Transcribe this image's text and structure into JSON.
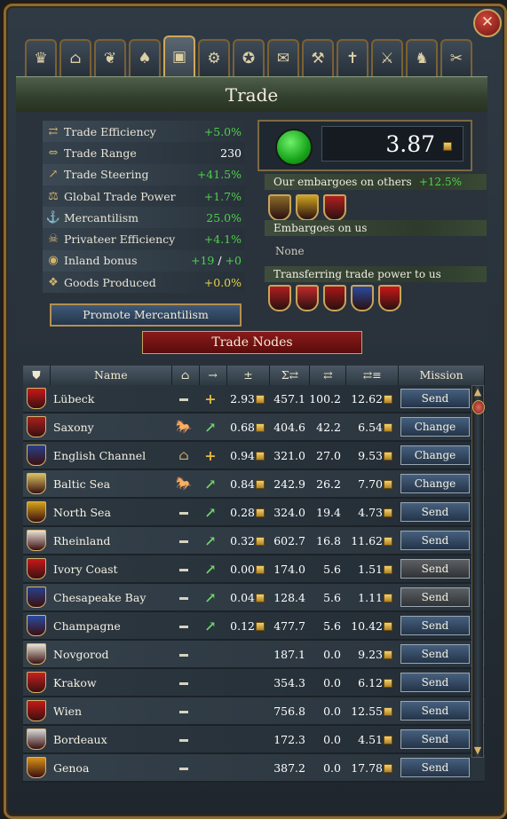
{
  "window": {
    "title": "Trade",
    "close_label": "✕"
  },
  "tabs": [
    {
      "icon": "crown-icon",
      "glyph": "♛"
    },
    {
      "icon": "building-icon",
      "glyph": "⌂"
    },
    {
      "icon": "dove-icon",
      "glyph": "❦"
    },
    {
      "icon": "sacks-icon",
      "glyph": "♠"
    },
    {
      "icon": "trade-crate-icon",
      "glyph": "▣"
    },
    {
      "icon": "gear-icon",
      "glyph": "⚙"
    },
    {
      "icon": "bulb-icon",
      "glyph": "✪"
    },
    {
      "icon": "scroll-icon",
      "glyph": "✉"
    },
    {
      "icon": "hammer-icon",
      "glyph": "⚒"
    },
    {
      "icon": "cross-icon",
      "glyph": "✝"
    },
    {
      "icon": "cannon-icon",
      "glyph": "⚔"
    },
    {
      "icon": "helmet-icon",
      "glyph": "♞"
    },
    {
      "icon": "tools-icon",
      "glyph": "✂"
    }
  ],
  "stats": [
    {
      "icon": "trade-efficiency-icon",
      "glyph": "⇄",
      "label": "Trade Efficiency",
      "value": "+5.0%",
      "color": "green"
    },
    {
      "icon": "trade-range-icon",
      "glyph": "⇔",
      "label": "Trade Range",
      "value": "230",
      "color": "white"
    },
    {
      "icon": "trade-steering-icon",
      "glyph": "↗",
      "label": "Trade Steering",
      "value": "+41.5%",
      "color": "green"
    },
    {
      "icon": "global-trade-power-icon",
      "glyph": "⚖",
      "label": "Global Trade Power",
      "value": "+1.7%",
      "color": "green"
    },
    {
      "icon": "mercantilism-icon",
      "glyph": "⚓",
      "label": "Mercantilism",
      "value": "25.0%",
      "color": "green"
    },
    {
      "icon": "privateer-icon",
      "glyph": "☠",
      "label": "Privateer Efficiency",
      "value": "+4.1%",
      "color": "green"
    },
    {
      "icon": "inland-bonus-icon",
      "glyph": "◉",
      "label": "Inland bonus",
      "value_a": "+19",
      "sep": " / ",
      "value_b": "+0",
      "color": "green"
    },
    {
      "icon": "goods-produced-icon",
      "glyph": "❖",
      "label": "Goods Produced",
      "value": "+0.0%",
      "color": "yellow"
    }
  ],
  "promote_label": "Promote Mercantilism",
  "income": {
    "value": "3.87"
  },
  "embargoes_others": {
    "label": "Our embargoes on others",
    "value": "+12.5%",
    "shields": [
      "#8a6a2a",
      "#c9a020",
      "#b02020"
    ]
  },
  "embargoes_us": {
    "label": "Embargoes on us",
    "none_label": "None"
  },
  "transferring": {
    "label": "Transferring trade power to us",
    "shields": [
      "#b01e1e",
      "#c02a2a",
      "#a81818",
      "#2a4aa0",
      "#c81818"
    ]
  },
  "nodes_banner": "Trade Nodes",
  "table": {
    "headers": {
      "name": "Name",
      "home_icon": "⌂",
      "arrow_icon": "→",
      "plusminus": "±",
      "total_icon": "Σ⇄",
      "own_icon": "⇄",
      "income_icon": "⇄≡",
      "mission": "Mission"
    },
    "rows": [
      {
        "flag": "#c81818",
        "name": "Lübeck",
        "home": "—",
        "arrow": "+",
        "val": "2.93",
        "total": "457.1",
        "own": "100.2",
        "income": "12.62",
        "mission": "Send",
        "dark": false
      },
      {
        "flag": "#a8201c",
        "name": "Saxony",
        "home": "🐎",
        "arrow": "↗",
        "val": "0.68",
        "total": "404.6",
        "own": "42.2",
        "income": "6.54",
        "mission": "Change",
        "dark": false
      },
      {
        "flag": "#2a3f8a",
        "name": "English Channel",
        "home": "⌂",
        "arrow": "+",
        "val": "0.94",
        "total": "321.0",
        "own": "27.0",
        "income": "9.53",
        "mission": "Change",
        "dark": false
      },
      {
        "flag": "#d8c060",
        "name": "Baltic Sea",
        "home": "🐎",
        "arrow": "↗",
        "val": "0.84",
        "total": "242.9",
        "own": "26.2",
        "income": "7.70",
        "mission": "Change",
        "dark": false
      },
      {
        "flag": "#d4a018",
        "name": "North Sea",
        "home": "—",
        "arrow": "↗",
        "val": "0.28",
        "total": "324.0",
        "own": "19.4",
        "income": "4.73",
        "mission": "Send",
        "dark": false
      },
      {
        "flag": "#e8e0d8",
        "name": "Rheinland",
        "home": "—",
        "arrow": "↗",
        "val": "0.32",
        "total": "602.7",
        "own": "16.8",
        "income": "11.62",
        "mission": "Send",
        "dark": false
      },
      {
        "flag": "#c81818",
        "name": "Ivory Coast",
        "home": "—",
        "arrow": "↗",
        "val": "0.00",
        "total": "174.0",
        "own": "5.6",
        "income": "1.51",
        "mission": "Send",
        "dark": true
      },
      {
        "flag": "#2a3f8a",
        "name": "Chesapeake Bay",
        "home": "—",
        "arrow": "↗",
        "val": "0.04",
        "total": "128.4",
        "own": "5.6",
        "income": "1.11",
        "mission": "Send",
        "dark": true
      },
      {
        "flag": "#2a4aa0",
        "name": "Champagne",
        "home": "—",
        "arrow": "↗",
        "val": "0.12",
        "total": "477.7",
        "own": "5.6",
        "income": "10.42",
        "mission": "Send",
        "dark": false
      },
      {
        "flag": "#e8e4d8",
        "name": "Novgorod",
        "home": "—",
        "arrow": "",
        "val": "",
        "total": "187.1",
        "own": "0.0",
        "income": "9.23",
        "mission": "Send",
        "dark": false
      },
      {
        "flag": "#c82020",
        "name": "Krakow",
        "home": "—",
        "arrow": "",
        "val": "",
        "total": "354.3",
        "own": "0.0",
        "income": "6.12",
        "mission": "Send",
        "dark": false
      },
      {
        "flag": "#c81818",
        "name": "Wien",
        "home": "—",
        "arrow": "",
        "val": "",
        "total": "756.8",
        "own": "0.0",
        "income": "12.55",
        "mission": "Send",
        "dark": false
      },
      {
        "flag": "#d8d8d8",
        "name": "Bordeaux",
        "home": "—",
        "arrow": "",
        "val": "",
        "total": "172.3",
        "own": "0.0",
        "income": "4.51",
        "mission": "Send",
        "dark": false
      },
      {
        "flag": "#d89018",
        "name": "Genoa",
        "home": "—",
        "arrow": "",
        "val": "",
        "total": "387.2",
        "own": "0.0",
        "income": "17.78",
        "mission": "Send",
        "dark": false
      }
    ]
  },
  "scroll": {
    "up": "▲",
    "down": "▼"
  }
}
